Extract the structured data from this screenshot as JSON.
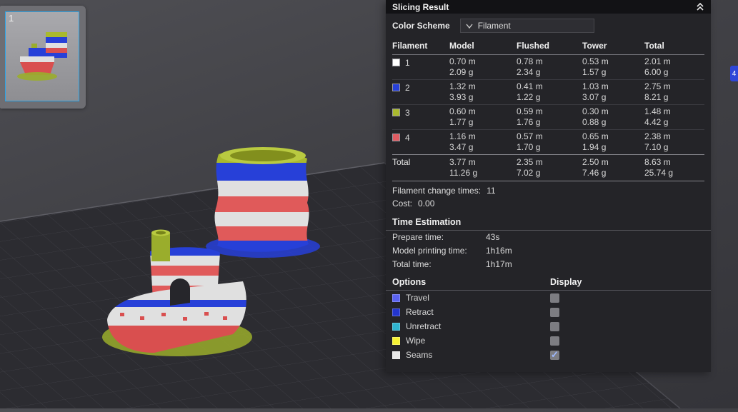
{
  "viewport": {
    "plate_number": "1",
    "legend_tab": {
      "label": "4",
      "color": "#2f46d8"
    }
  },
  "panel": {
    "title": "Slicing Result",
    "color_scheme": {
      "label": "Color Scheme",
      "value": "Filament"
    },
    "table": {
      "headers": [
        "Filament",
        "Model",
        "Flushed",
        "Tower",
        "Total"
      ],
      "rows": [
        {
          "id": "1",
          "color": "#ffffff",
          "model_m": "0.70 m",
          "model_g": "2.09 g",
          "flushed_m": "0.78 m",
          "flushed_g": "2.34 g",
          "tower_m": "0.53 m",
          "tower_g": "1.57 g",
          "total_m": "2.01 m",
          "total_g": "6.00 g"
        },
        {
          "id": "2",
          "color": "#2740d8",
          "model_m": "1.32 m",
          "model_g": "3.93 g",
          "flushed_m": "0.41 m",
          "flushed_g": "1.22 g",
          "tower_m": "1.03 m",
          "tower_g": "3.07 g",
          "total_m": "2.75 m",
          "total_g": "8.21 g"
        },
        {
          "id": "3",
          "color": "#a9b92e",
          "model_m": "0.60 m",
          "model_g": "1.77 g",
          "flushed_m": "0.59 m",
          "flushed_g": "1.76 g",
          "tower_m": "0.30 m",
          "tower_g": "0.88 g",
          "total_m": "1.48 m",
          "total_g": "4.42 g"
        },
        {
          "id": "4",
          "color": "#e05c62",
          "model_m": "1.16 m",
          "model_g": "3.47 g",
          "flushed_m": "0.57 m",
          "flushed_g": "1.70 g",
          "tower_m": "0.65 m",
          "tower_g": "1.94 g",
          "total_m": "2.38 m",
          "total_g": "7.10 g"
        }
      ],
      "total_row": {
        "label": "Total",
        "model_m": "3.77 m",
        "model_g": "11.26 g",
        "flushed_m": "2.35 m",
        "flushed_g": "7.02 g",
        "tower_m": "2.50 m",
        "tower_g": "7.46 g",
        "total_m": "8.63 m",
        "total_g": "25.74 g"
      }
    },
    "filament_change": {
      "label": "Filament change times:",
      "value": "11"
    },
    "cost": {
      "label": "Cost:",
      "value": "0.00"
    },
    "time_estimation": {
      "title": "Time Estimation",
      "rows": [
        {
          "label": "Prepare time:",
          "value": "43s"
        },
        {
          "label": "Model printing time:",
          "value": "1h16m"
        },
        {
          "label": "Total time:",
          "value": "1h17m"
        }
      ]
    },
    "options": {
      "title": "Options",
      "display_header": "Display",
      "items": [
        {
          "label": "Travel",
          "color": "#5a62f0",
          "checked": false
        },
        {
          "label": "Retract",
          "color": "#2335cf",
          "checked": false
        },
        {
          "label": "Unretract",
          "color": "#2fb4cf",
          "checked": false
        },
        {
          "label": "Wipe",
          "color": "#f5f133",
          "checked": false
        },
        {
          "label": "Seams",
          "color": "#e8e8e8",
          "checked": true
        }
      ]
    }
  }
}
